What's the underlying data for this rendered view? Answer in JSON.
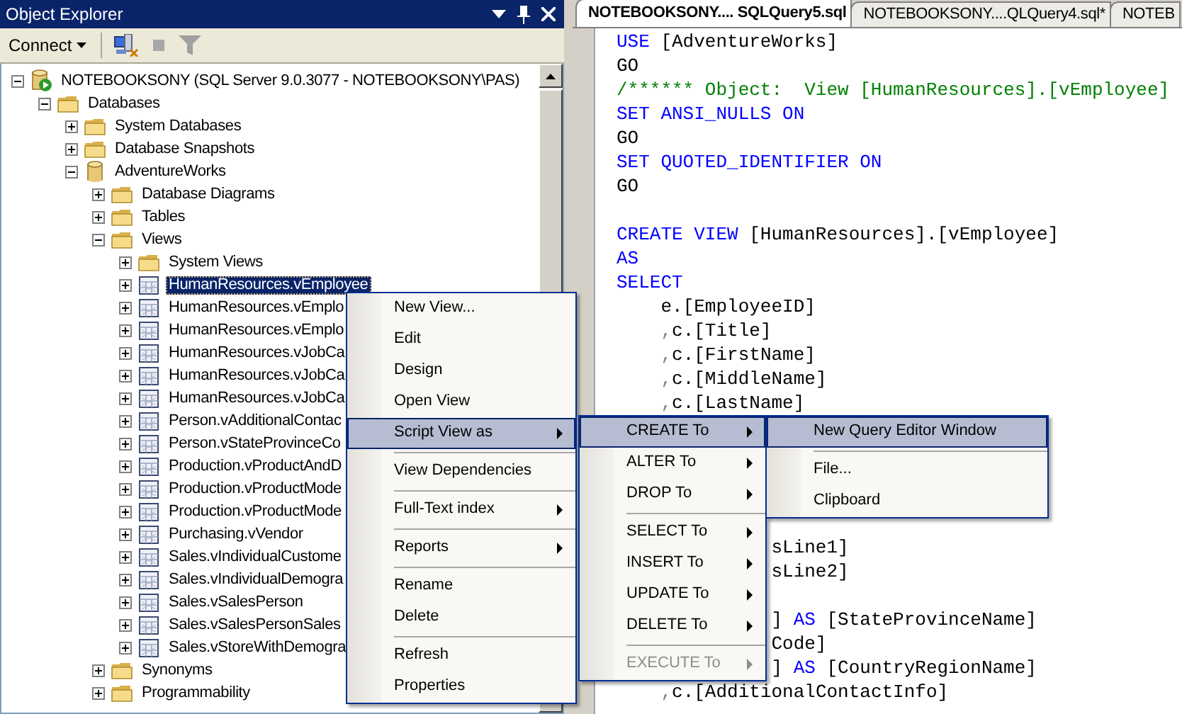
{
  "object_explorer": {
    "title": "Object Explorer",
    "connect": "Connect",
    "tree": [
      {
        "label": "NOTEBOOKSONY (SQL Server 9.0.3077 - NOTEBOOKSONY\\PAS)",
        "kind": "server",
        "expanded": true,
        "selected": false,
        "children": [
          {
            "label": "Databases",
            "kind": "folder",
            "expanded": true,
            "selected": false,
            "children": [
              {
                "label": "System Databases",
                "kind": "folder",
                "expanded": false,
                "selected": false
              },
              {
                "label": "Database Snapshots",
                "kind": "folder",
                "expanded": false,
                "selected": false
              },
              {
                "label": "AdventureWorks",
                "kind": "database",
                "expanded": true,
                "selected": false,
                "children": [
                  {
                    "label": "Database Diagrams",
                    "kind": "folder",
                    "expanded": false,
                    "selected": false
                  },
                  {
                    "label": "Tables",
                    "kind": "folder",
                    "expanded": false,
                    "selected": false
                  },
                  {
                    "label": "Views",
                    "kind": "folder",
                    "expanded": true,
                    "selected": false,
                    "children": [
                      {
                        "label": "System Views",
                        "kind": "folder",
                        "expanded": false,
                        "selected": false
                      },
                      {
                        "label": "HumanResources.vEmployee",
                        "kind": "view",
                        "expanded": false,
                        "selected": true
                      },
                      {
                        "label": "HumanResources.vEmplo",
                        "kind": "view",
                        "expanded": false,
                        "selected": false
                      },
                      {
                        "label": "HumanResources.vEmplo",
                        "kind": "view",
                        "expanded": false,
                        "selected": false
                      },
                      {
                        "label": "HumanResources.vJobCa",
                        "kind": "view",
                        "expanded": false,
                        "selected": false
                      },
                      {
                        "label": "HumanResources.vJobCa",
                        "kind": "view",
                        "expanded": false,
                        "selected": false
                      },
                      {
                        "label": "HumanResources.vJobCa",
                        "kind": "view",
                        "expanded": false,
                        "selected": false
                      },
                      {
                        "label": "Person.vAdditionalContac",
                        "kind": "view",
                        "expanded": false,
                        "selected": false
                      },
                      {
                        "label": "Person.vStateProvinceCo",
                        "kind": "view",
                        "expanded": false,
                        "selected": false
                      },
                      {
                        "label": "Production.vProductAndD",
                        "kind": "view",
                        "expanded": false,
                        "selected": false
                      },
                      {
                        "label": "Production.vProductMode",
                        "kind": "view",
                        "expanded": false,
                        "selected": false
                      },
                      {
                        "label": "Production.vProductMode",
                        "kind": "view",
                        "expanded": false,
                        "selected": false
                      },
                      {
                        "label": "Purchasing.vVendor",
                        "kind": "view",
                        "expanded": false,
                        "selected": false
                      },
                      {
                        "label": "Sales.vIndividualCustome",
                        "kind": "view",
                        "expanded": false,
                        "selected": false
                      },
                      {
                        "label": "Sales.vIndividualDemogra",
                        "kind": "view",
                        "expanded": false,
                        "selected": false
                      },
                      {
                        "label": "Sales.vSalesPerson",
                        "kind": "view",
                        "expanded": false,
                        "selected": false
                      },
                      {
                        "label": "Sales.vSalesPersonSales",
                        "kind": "view",
                        "expanded": false,
                        "selected": false
                      },
                      {
                        "label": "Sales.vStoreWithDemogra",
                        "kind": "view",
                        "expanded": false,
                        "selected": false
                      }
                    ]
                  },
                  {
                    "label": "Synonyms",
                    "kind": "folder",
                    "expanded": false,
                    "selected": false
                  },
                  {
                    "label": "Programmability",
                    "kind": "folder",
                    "expanded": false,
                    "selected": false
                  }
                ]
              }
            ]
          }
        ]
      }
    ]
  },
  "editor": {
    "tabs": [
      {
        "label": "NOTEBOOKSONY.... SQLQuery5.sql",
        "selected": true
      },
      {
        "label": "NOTEBOOKSONY....QLQuery4.sql*",
        "selected": false
      },
      {
        "label": "NOTEB",
        "selected": false
      }
    ],
    "lines": [
      {
        "kind": "code",
        "tokens": [
          {
            "kind": "keyword",
            "text": "USE"
          },
          {
            "kind": "plain",
            "text": " [AdventureWorks]"
          }
        ]
      },
      {
        "kind": "code",
        "tokens": [
          {
            "kind": "plain",
            "text": "GO"
          }
        ]
      },
      {
        "kind": "code",
        "tokens": [
          {
            "kind": "comment",
            "text": "/****** Object:  View [HumanResources].[vEmployee]"
          }
        ]
      },
      {
        "kind": "code",
        "tokens": [
          {
            "kind": "keyword",
            "text": "SET ANSI_NULLS ON"
          }
        ]
      },
      {
        "kind": "code",
        "tokens": [
          {
            "kind": "plain",
            "text": "GO"
          }
        ]
      },
      {
        "kind": "code",
        "tokens": [
          {
            "kind": "keyword",
            "text": "SET QUOTED_IDENTIFIER ON"
          }
        ]
      },
      {
        "kind": "code",
        "tokens": [
          {
            "kind": "plain",
            "text": "GO"
          }
        ]
      },
      {
        "kind": "blank"
      },
      {
        "kind": "code",
        "tokens": [
          {
            "kind": "keyword",
            "text": "CREATE VIEW"
          },
          {
            "kind": "plain",
            "text": " [HumanResources].[vEmployee]"
          }
        ]
      },
      {
        "kind": "code",
        "tokens": [
          {
            "kind": "keyword",
            "text": "AS"
          }
        ]
      },
      {
        "kind": "code",
        "tokens": [
          {
            "kind": "keyword",
            "text": "SELECT"
          }
        ]
      },
      {
        "kind": "code",
        "tokens": [
          {
            "kind": "plain",
            "text": "    e.[EmployeeID]"
          }
        ]
      },
      {
        "kind": "code",
        "tokens": [
          {
            "kind": "operator",
            "text": "    ,"
          },
          {
            "kind": "plain",
            "text": "c.[Title]"
          }
        ]
      },
      {
        "kind": "code",
        "tokens": [
          {
            "kind": "operator",
            "text": "    ,"
          },
          {
            "kind": "plain",
            "text": "c.[FirstName]"
          }
        ]
      },
      {
        "kind": "code",
        "tokens": [
          {
            "kind": "operator",
            "text": "    ,"
          },
          {
            "kind": "plain",
            "text": "c.[MiddleName]"
          }
        ]
      },
      {
        "kind": "code",
        "tokens": [
          {
            "kind": "operator",
            "text": "    ,"
          },
          {
            "kind": "plain",
            "text": "c.[LastName]"
          }
        ]
      },
      {
        "kind": "blank"
      },
      {
        "kind": "blank"
      },
      {
        "kind": "blank"
      },
      {
        "kind": "blank"
      },
      {
        "kind": "blank"
      },
      {
        "kind": "code",
        "tokens": [
          {
            "kind": "plain",
            "text": "              sLine1]"
          }
        ]
      },
      {
        "kind": "code",
        "tokens": [
          {
            "kind": "plain",
            "text": "              sLine2]"
          }
        ]
      },
      {
        "kind": "blank"
      },
      {
        "kind": "code",
        "tokens": [
          {
            "kind": "plain",
            "text": "              ] "
          },
          {
            "kind": "keyword",
            "text": "AS"
          },
          {
            "kind": "plain",
            "text": " [StateProvinceName]"
          }
        ]
      },
      {
        "kind": "code",
        "tokens": [
          {
            "kind": "plain",
            "text": "              Code]"
          }
        ]
      },
      {
        "kind": "code",
        "tokens": [
          {
            "kind": "plain",
            "text": "              ] "
          },
          {
            "kind": "keyword",
            "text": "AS"
          },
          {
            "kind": "plain",
            "text": " [CountryRegionName]"
          }
        ]
      },
      {
        "kind": "code",
        "tokens": [
          {
            "kind": "operator",
            "text": "    ,"
          },
          {
            "kind": "plain",
            "text": "c.[AdditionalContactInfo]"
          }
        ]
      }
    ]
  },
  "context_menu": {
    "items": [
      {
        "kind": "item",
        "label": "New View...",
        "selected": false,
        "submenu": false,
        "disabled": false
      },
      {
        "kind": "item",
        "label": "Edit",
        "selected": false,
        "submenu": false,
        "disabled": false
      },
      {
        "kind": "item",
        "label": "Design",
        "selected": false,
        "submenu": false,
        "disabled": false
      },
      {
        "kind": "item",
        "label": "Open View",
        "selected": false,
        "submenu": false,
        "disabled": false
      },
      {
        "kind": "item",
        "label": "Script View as",
        "selected": true,
        "submenu": true,
        "disabled": false
      },
      {
        "kind": "separator"
      },
      {
        "kind": "item",
        "label": "View Dependencies",
        "selected": false,
        "submenu": false,
        "disabled": false
      },
      {
        "kind": "separator"
      },
      {
        "kind": "item",
        "label": "Full-Text index",
        "selected": false,
        "submenu": true,
        "disabled": false
      },
      {
        "kind": "separator"
      },
      {
        "kind": "item",
        "label": "Reports",
        "selected": false,
        "submenu": true,
        "disabled": false
      },
      {
        "kind": "separator"
      },
      {
        "kind": "item",
        "label": "Rename",
        "selected": false,
        "submenu": false,
        "disabled": false
      },
      {
        "kind": "item",
        "label": "Delete",
        "selected": false,
        "submenu": false,
        "disabled": false
      },
      {
        "kind": "separator"
      },
      {
        "kind": "item",
        "label": "Refresh",
        "selected": false,
        "submenu": false,
        "disabled": false
      },
      {
        "kind": "item",
        "label": "Properties",
        "selected": false,
        "submenu": false,
        "disabled": false
      }
    ]
  },
  "script_submenu": {
    "items": [
      {
        "kind": "item",
        "label": "CREATE To",
        "selected": true,
        "submenu": true,
        "disabled": false
      },
      {
        "kind": "item",
        "label": "ALTER To",
        "selected": false,
        "submenu": true,
        "disabled": false
      },
      {
        "kind": "item",
        "label": "DROP To",
        "selected": false,
        "submenu": true,
        "disabled": false
      },
      {
        "kind": "separator"
      },
      {
        "kind": "item",
        "label": "SELECT To",
        "selected": false,
        "submenu": true,
        "disabled": false
      },
      {
        "kind": "item",
        "label": "INSERT To",
        "selected": false,
        "submenu": true,
        "disabled": false
      },
      {
        "kind": "item",
        "label": "UPDATE To",
        "selected": false,
        "submenu": true,
        "disabled": false
      },
      {
        "kind": "item",
        "label": "DELETE To",
        "selected": false,
        "submenu": true,
        "disabled": false
      },
      {
        "kind": "separator"
      },
      {
        "kind": "item",
        "label": "EXECUTE To",
        "selected": false,
        "submenu": true,
        "disabled": true
      }
    ]
  },
  "create_submenu": {
    "items": [
      {
        "kind": "item",
        "label": "New Query Editor Window",
        "selected": true,
        "submenu": false,
        "disabled": false
      },
      {
        "kind": "separator"
      },
      {
        "kind": "item",
        "label": "File...",
        "selected": false,
        "submenu": false,
        "disabled": false
      },
      {
        "kind": "item",
        "label": "Clipboard",
        "selected": false,
        "submenu": false,
        "disabled": false
      }
    ]
  }
}
